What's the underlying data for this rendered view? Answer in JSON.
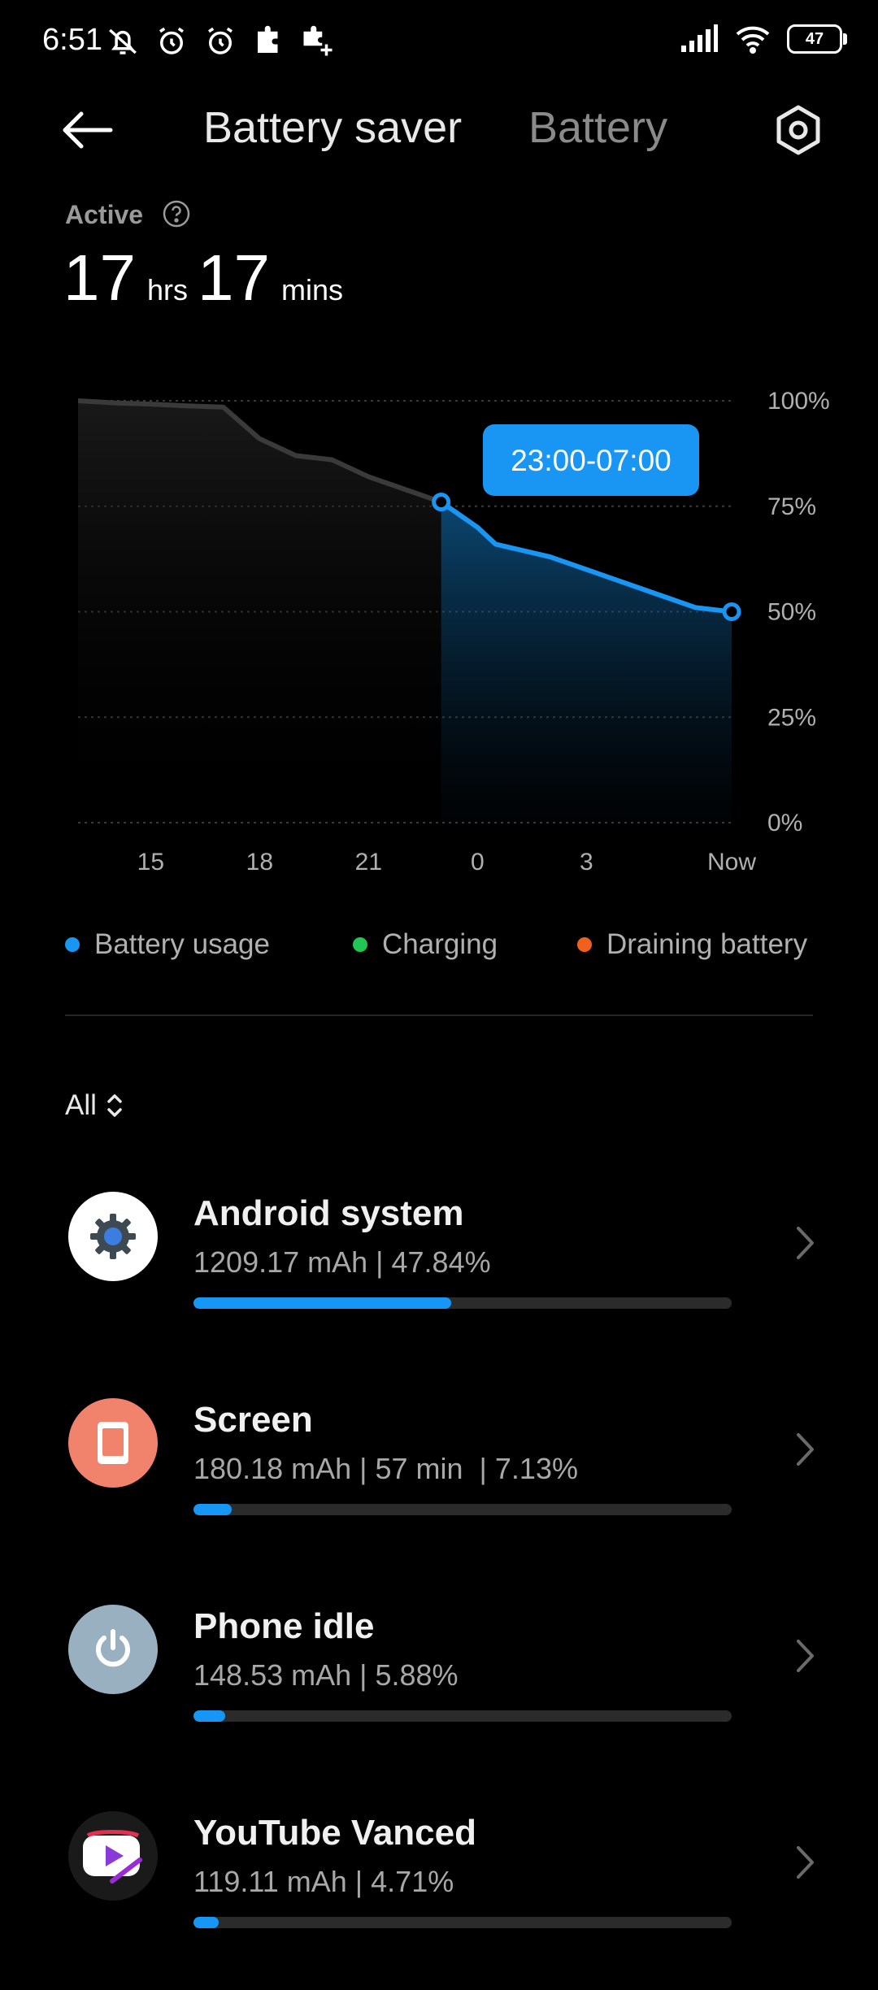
{
  "status_bar": {
    "time": "6:51",
    "battery_level": "47"
  },
  "header": {
    "tabs": [
      {
        "label": "Battery saver",
        "active": true
      },
      {
        "label": "Battery",
        "active": false
      }
    ]
  },
  "active": {
    "label": "Active",
    "hours": "17",
    "hours_unit": "hrs",
    "minutes": "17",
    "minutes_unit": "mins"
  },
  "chart_data": {
    "type": "line",
    "x_ticks": [
      "15",
      "18",
      "21",
      "0",
      "3",
      "Now"
    ],
    "y_ticks": [
      "100%",
      "75%",
      "50%",
      "25%",
      "0%"
    ],
    "ylim": [
      0,
      100
    ],
    "highlight_label": "23:00-07:00",
    "series": [
      {
        "name": "Battery usage",
        "x": [
          "13:00",
          "14:00",
          "15:00",
          "16:00",
          "17:00",
          "18:00",
          "19:00",
          "20:00",
          "21:00",
          "22:00",
          "23:00",
          "00:00",
          "00:30",
          "01:00",
          "02:00",
          "03:00",
          "04:00",
          "05:00",
          "06:00",
          "07:00"
        ],
        "values": [
          100,
          99.5,
          99.2,
          98.8,
          98.5,
          91,
          87,
          86,
          82,
          79,
          76,
          70,
          66,
          65,
          63,
          60,
          57,
          54,
          51,
          50
        ]
      }
    ],
    "grid": true
  },
  "legend": [
    {
      "label": "Battery usage",
      "color": "#1996f3"
    },
    {
      "label": "Charging",
      "color": "#21c654"
    },
    {
      "label": "Draining battery",
      "color": "#f2601f"
    }
  ],
  "filter": {
    "label": "All"
  },
  "apps": [
    {
      "name": "Android system",
      "detail": "1209.17 mAh | 47.84%",
      "share": 0.4784,
      "icon": "android-system-gear-icon",
      "icon_bg": "#ffffff"
    },
    {
      "name": "Screen",
      "detail": "180.18 mAh | 57 min  | 7.13%",
      "share": 0.0713,
      "icon": "screen-phone-icon",
      "icon_bg": "#f1826c"
    },
    {
      "name": "Phone idle",
      "detail": "148.53 mAh | 5.88%",
      "share": 0.0588,
      "icon": "power-icon",
      "icon_bg": "#98b0c0"
    },
    {
      "name": "YouTube Vanced",
      "detail": "119.11 mAh | 4.71%",
      "share": 0.0471,
      "icon": "youtube-vanced-icon",
      "icon_bg": "#1a1a1a"
    }
  ]
}
